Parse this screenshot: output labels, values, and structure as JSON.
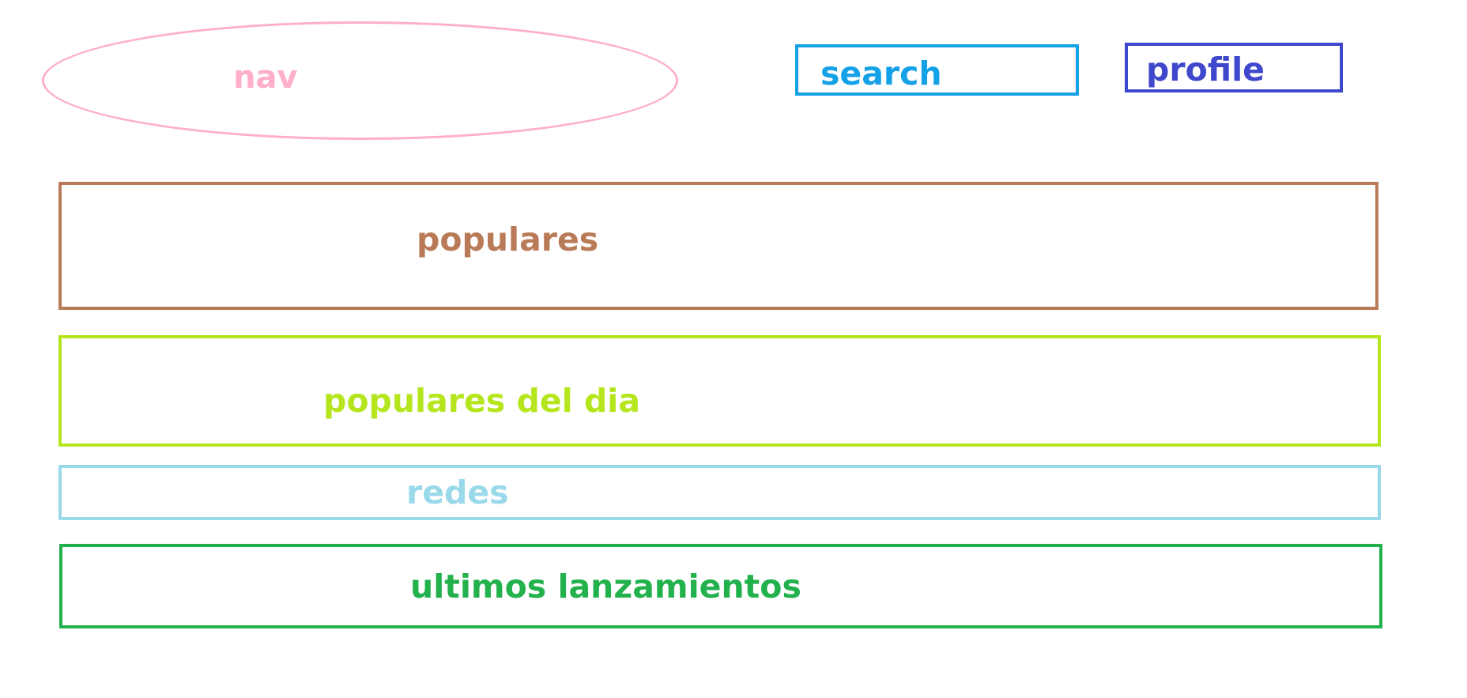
{
  "nav": {
    "label": "nav",
    "color": "#ffaecb"
  },
  "search": {
    "label": "search",
    "color": "#14a1e6"
  },
  "profile": {
    "label": "profile",
    "color": "#3f48cc"
  },
  "sections": {
    "populares": {
      "label": "populares",
      "color": "#b97a57"
    },
    "populares_dia": {
      "label": "populares del dia",
      "color": "#b5e61d"
    },
    "redes": {
      "label": "redes",
      "color": "#99d9ea"
    },
    "ultimos": {
      "label": "ultimos lanzamientos",
      "color": "#22b14c"
    }
  }
}
